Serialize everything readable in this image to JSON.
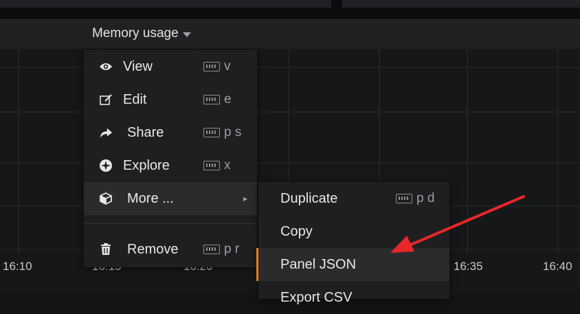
{
  "panel": {
    "title": "Memory usage",
    "x_ticks": [
      "16:10",
      "16:15",
      "16:20",
      "16:35",
      "16:40"
    ]
  },
  "context_menu": {
    "items": [
      {
        "label": "View",
        "shortcut": "v",
        "icon": "eye-icon"
      },
      {
        "label": "Edit",
        "shortcut": "e",
        "icon": "edit-icon"
      },
      {
        "label": "Share",
        "shortcut": "p s",
        "icon": "share-icon"
      },
      {
        "label": "Explore",
        "shortcut": "x",
        "icon": "compass-icon"
      },
      {
        "label": "More ...",
        "icon": "cube-icon"
      },
      {
        "label": "Remove",
        "shortcut": "p r",
        "icon": "trash-icon"
      }
    ]
  },
  "submenu": {
    "items": [
      {
        "label": "Duplicate",
        "shortcut": "p d"
      },
      {
        "label": "Copy"
      },
      {
        "label": "Panel JSON"
      },
      {
        "label": "Export CSV"
      }
    ]
  },
  "colors": {
    "accent": "#eb7b18",
    "arrow": "#e8262b"
  }
}
